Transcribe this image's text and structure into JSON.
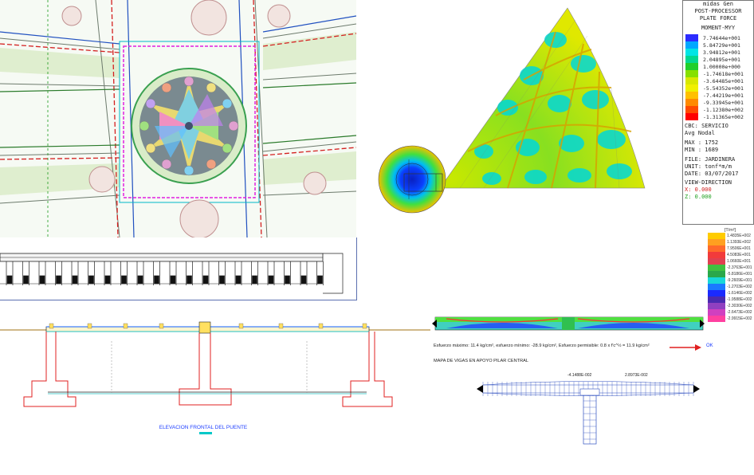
{
  "legend": {
    "app": "midas Gen",
    "mode": "POST-PROCESSOR",
    "type": "PLATE FORCE",
    "component": "MOMENT-MYY",
    "values": [
      "7.74644e+001",
      "5.84729e+001",
      "3.94812e+001",
      "2.04895e+001",
      "1.00000e+000",
      "-1.74618e+001",
      "-3.64485e+001",
      "-5.54352e+001",
      "-7.44219e+001",
      "-9.33945e+001",
      "-1.12380e+002",
      "-1.31365e+002"
    ],
    "colors": [
      "#2b2bff",
      "#00a8ff",
      "#00e5e5",
      "#00d890",
      "#1fcf2a",
      "#86e000",
      "#d8e800",
      "#f0f000",
      "#ffc000",
      "#ff8a00",
      "#ff4a00",
      "#ff0000"
    ],
    "case": "CBC: SERVICIO",
    "avg": "Avg Nodal",
    "max": "MAX : 1752",
    "min": "MIN : 1689",
    "file": "FILE: JARDINERA",
    "unit": "UNIT: tonf*m/m",
    "date": "DATE: 03/07/2017",
    "view": "VIEW-DIRECTION",
    "x": "X: 0.000",
    "z": "Z: 0.000"
  },
  "stress_scale": {
    "unit": "[T/m²]",
    "values": [
      "1.4835E+002",
      "1.1393E+002",
      "7.9506E+001",
      "4.5083E+001",
      "1.0660E+001",
      "-2.3763E+001",
      "-5.8186E+001",
      "-9.2609E+001",
      "-1.2703E+002",
      "-1.6146E+002",
      "-1.9588E+002",
      "-2.3030E+002",
      "-2.6473E+002",
      "-2.9915E+002"
    ],
    "colors": [
      "#ffcc00",
      "#ffa020",
      "#ff6a2a",
      "#f23b3b",
      "#e04050",
      "#3fc040",
      "#2aa84a",
      "#18d8d8",
      "#1a7aff",
      "#1a2aff",
      "#4a2ab0",
      "#9040c0",
      "#d040c0",
      "#ff40a0"
    ]
  },
  "notes": {
    "stress_line": "Esfuerzo máximo: 11.4 kg/cm², esfuerzo mínimo: -28.9 kg/cm², Esfuerzo permisible: 0.8 x f'c^½ = 11.9 kg/cm²",
    "ok": "OK",
    "map_title": "MAPA DE VIGAS EN APOYO PILAR CENTRAL",
    "left_val": "-4.1488E-002",
    "right_val": "2.8973E-002",
    "elevation_title": "ELEVACION FRONTAL DEL PUENTE"
  }
}
